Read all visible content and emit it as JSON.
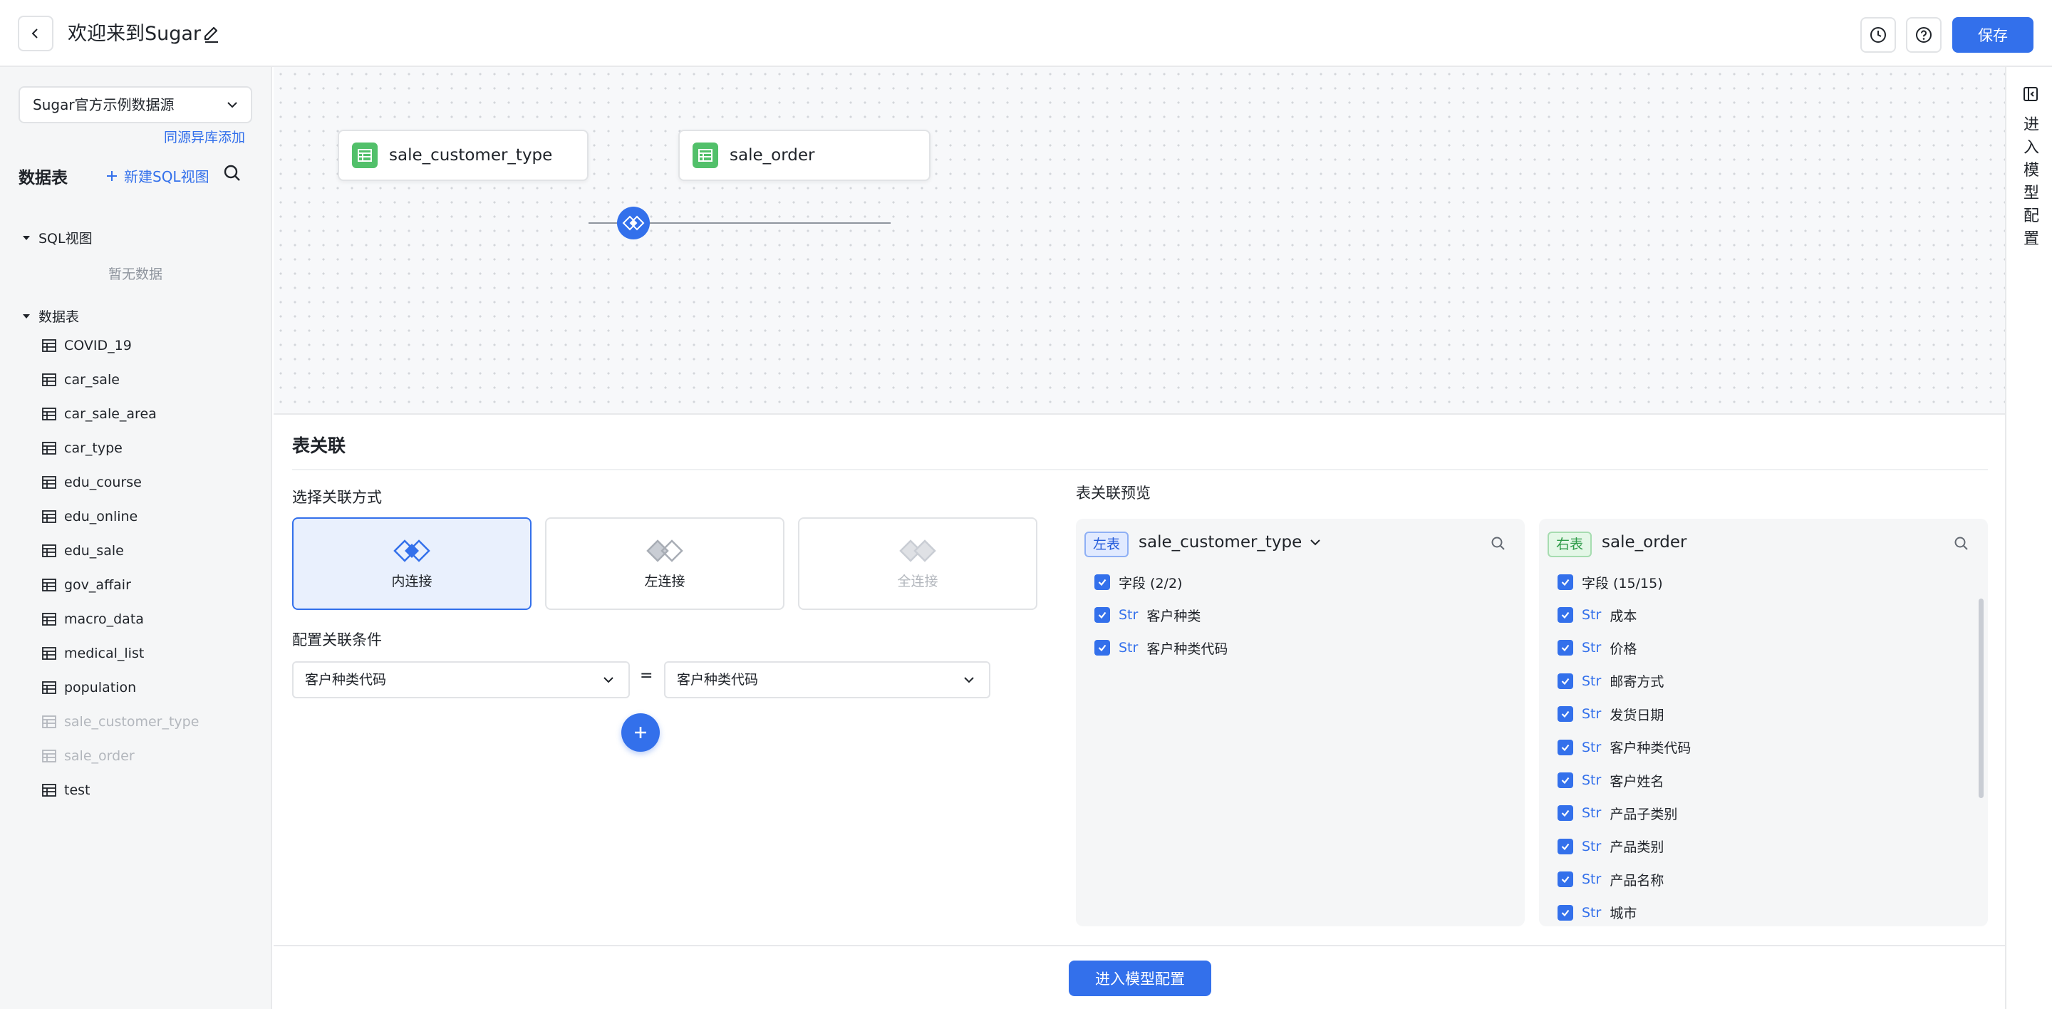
{
  "header": {
    "title": "欢迎来到Sugar",
    "save_label": "保存"
  },
  "sidebar": {
    "datasource": "Sugar官方示例数据源",
    "same_source_link": "同源异库添加",
    "tables_heading": "数据表",
    "new_sql_view": "新建SQL视图",
    "groups": {
      "sql_view": "SQL视图",
      "sql_view_empty": "暂无数据",
      "tables": "数据表"
    },
    "tables": [
      {
        "name": "COVID_19"
      },
      {
        "name": "car_sale"
      },
      {
        "name": "car_sale_area"
      },
      {
        "name": "car_type"
      },
      {
        "name": "edu_course"
      },
      {
        "name": "edu_online"
      },
      {
        "name": "edu_sale"
      },
      {
        "name": "gov_affair"
      },
      {
        "name": "macro_data"
      },
      {
        "name": "medical_list"
      },
      {
        "name": "population"
      },
      {
        "name": "sale_customer_type",
        "used": true
      },
      {
        "name": "sale_order",
        "used": true
      },
      {
        "name": "test"
      }
    ]
  },
  "canvas": {
    "left_node": "sale_customer_type",
    "right_node": "sale_order"
  },
  "right_strip": {
    "label": "进入模型配置"
  },
  "join_panel": {
    "title": "表关联",
    "select_type_title": "选择关联方式",
    "join_types": [
      {
        "label": "内连接",
        "state": "active"
      },
      {
        "label": "左连接",
        "state": "normal"
      },
      {
        "label": "全连接",
        "state": "disabled"
      }
    ],
    "condition_title": "配置关联条件",
    "condition": {
      "left_field": "客户种类代码",
      "operator": "=",
      "right_field": "客户种类代码"
    },
    "preview_title": "表关联预览",
    "left_preview": {
      "tag": "左表",
      "table": "sale_customer_type",
      "summary": "字段 (2/2)",
      "fields": [
        {
          "type": "Str",
          "name": "客户种类"
        },
        {
          "type": "Str",
          "name": "客户种类代码"
        }
      ]
    },
    "right_preview": {
      "tag": "右表",
      "table": "sale_order",
      "summary": "字段 (15/15)",
      "fields": [
        {
          "type": "Str",
          "name": "成本"
        },
        {
          "type": "Str",
          "name": "价格"
        },
        {
          "type": "Str",
          "name": "邮寄方式"
        },
        {
          "type": "Str",
          "name": "发货日期"
        },
        {
          "type": "Str",
          "name": "客户种类代码"
        },
        {
          "type": "Str",
          "name": "客户姓名"
        },
        {
          "type": "Str",
          "name": "产品子类别"
        },
        {
          "type": "Str",
          "name": "产品类别"
        },
        {
          "type": "Str",
          "name": "产品名称"
        },
        {
          "type": "Str",
          "name": "城市"
        }
      ]
    }
  },
  "footer": {
    "enter_model_config": "进入模型配置"
  },
  "colors": {
    "accent": "#3370eb",
    "table_icon": "#52c06a"
  }
}
